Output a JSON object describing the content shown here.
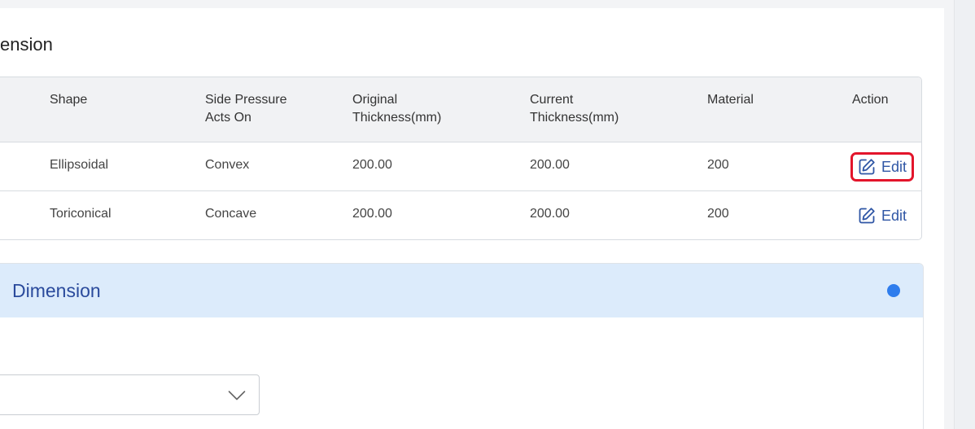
{
  "section": {
    "title": "ension"
  },
  "table": {
    "headers": [
      "Shape",
      "Side Pressure\nActs On",
      "Original\nThickness(mm)",
      "Current\nThickness(mm)",
      "Material",
      "Action"
    ],
    "rows": [
      {
        "shape": "Ellipsoidal",
        "side_pressure": "Convex",
        "original_thickness": "200.00",
        "current_thickness": "200.00",
        "material": "200",
        "action": "Edit"
      },
      {
        "shape": "Toriconical",
        "side_pressure": "Concave",
        "original_thickness": "200.00",
        "current_thickness": "200.00",
        "material": "200",
        "action": "Edit"
      }
    ]
  },
  "accordion": {
    "title": "Dimension",
    "status_color": "#2f7ded"
  },
  "dropdown": {
    "value": "",
    "icon": "chevron-down-icon"
  },
  "icons": {
    "edit": "edit-icon"
  },
  "colors": {
    "accent": "#2f56a5",
    "highlight": "#e3152b",
    "header_bg": "#dcebfb"
  }
}
